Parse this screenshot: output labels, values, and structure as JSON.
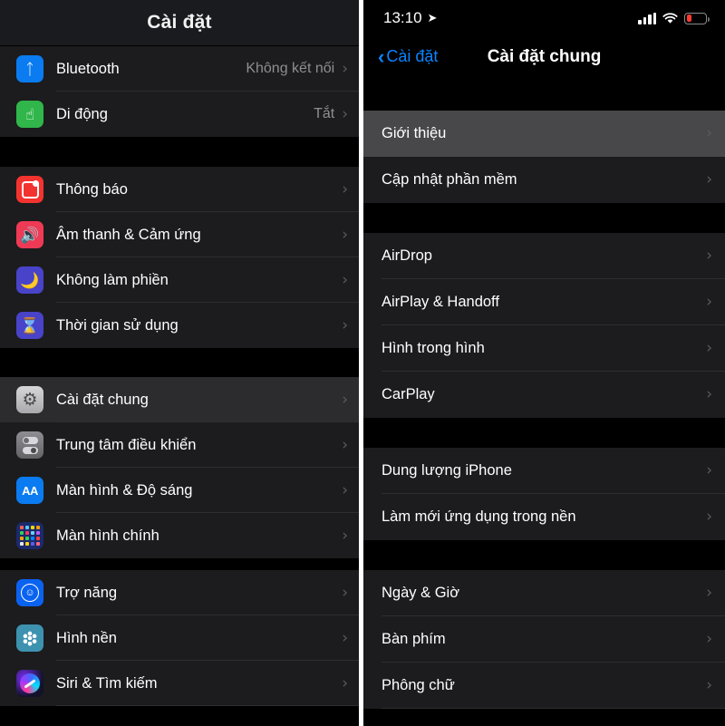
{
  "left_panel": {
    "header_title": "Cài đặt",
    "groups": [
      {
        "rows": [
          {
            "label": "Bluetooth",
            "value": "Không kết nối",
            "icon": "bluetooth-icon",
            "icon_class": "ic-bluetooth"
          },
          {
            "label": "Di động",
            "value": "Tắt",
            "icon": "cellular-icon",
            "icon_class": "ic-cellular"
          }
        ]
      },
      {
        "rows": [
          {
            "label": "Thông báo",
            "value": "",
            "icon": "notifications-icon",
            "icon_class": "ic-notif"
          },
          {
            "label": "Âm thanh & Cảm ứng",
            "value": "",
            "icon": "sounds-icon",
            "icon_class": "ic-sound"
          },
          {
            "label": "Không làm phiền",
            "value": "",
            "icon": "moon-icon",
            "icon_class": "ic-dnd"
          },
          {
            "label": "Thời gian sử dụng",
            "value": "",
            "icon": "hourglass-icon",
            "icon_class": "ic-screen"
          }
        ]
      },
      {
        "rows": [
          {
            "label": "Cài đặt chung",
            "value": "",
            "icon": "gear-icon",
            "icon_class": "ic-general",
            "selected": true
          },
          {
            "label": "Trung tâm điều khiển",
            "value": "",
            "icon": "control-center-icon",
            "icon_class": "ic-control"
          },
          {
            "label": "Màn hình & Độ sáng",
            "value": "",
            "icon": "display-brightness-icon",
            "icon_class": "ic-display"
          },
          {
            "label": "Màn hình chính",
            "value": "",
            "icon": "home-screen-icon",
            "icon_class": "ic-home"
          }
        ]
      },
      {
        "rows": [
          {
            "label": "Trợ năng",
            "value": "",
            "icon": "accessibility-icon",
            "icon_class": "ic-access"
          },
          {
            "label": "Hình nền",
            "value": "",
            "icon": "wallpaper-icon",
            "icon_class": "ic-wallpaper"
          },
          {
            "label": "Siri & Tìm kiếm",
            "value": "",
            "icon": "siri-icon",
            "icon_class": "ic-siri"
          }
        ]
      }
    ]
  },
  "right_panel": {
    "status": {
      "time": "13:10",
      "location_icon": "location-arrow-icon",
      "signal_icon": "cellular-bars-icon",
      "wifi_icon": "wifi-icon",
      "battery_icon": "battery-low-icon",
      "battery_color": "#ff3b30"
    },
    "nav": {
      "back_label": "Cài đặt",
      "back_icon": "chevron-left-icon",
      "title": "Cài đặt chung",
      "accent_color": "#0a84ff"
    },
    "groups": [
      {
        "rows": [
          {
            "label": "Giới thiệu",
            "selected": true
          },
          {
            "label": "Cập nhật phần mềm",
            "selected": false
          }
        ]
      },
      {
        "rows": [
          {
            "label": "AirDrop",
            "selected": false
          },
          {
            "label": "AirPlay & Handoff",
            "selected": false
          },
          {
            "label": "Hình trong hình",
            "selected": false
          },
          {
            "label": "CarPlay",
            "selected": false
          }
        ]
      },
      {
        "rows": [
          {
            "label": "Dung lượng iPhone",
            "selected": false
          },
          {
            "label": "Làm mới ứng dụng trong nền",
            "selected": false
          }
        ]
      },
      {
        "rows": [
          {
            "label": "Ngày & Giờ",
            "selected": false
          },
          {
            "label": "Bàn phím",
            "selected": false
          },
          {
            "label": "Phông chữ",
            "selected": false
          }
        ]
      }
    ]
  },
  "chevron_glyph": "›"
}
